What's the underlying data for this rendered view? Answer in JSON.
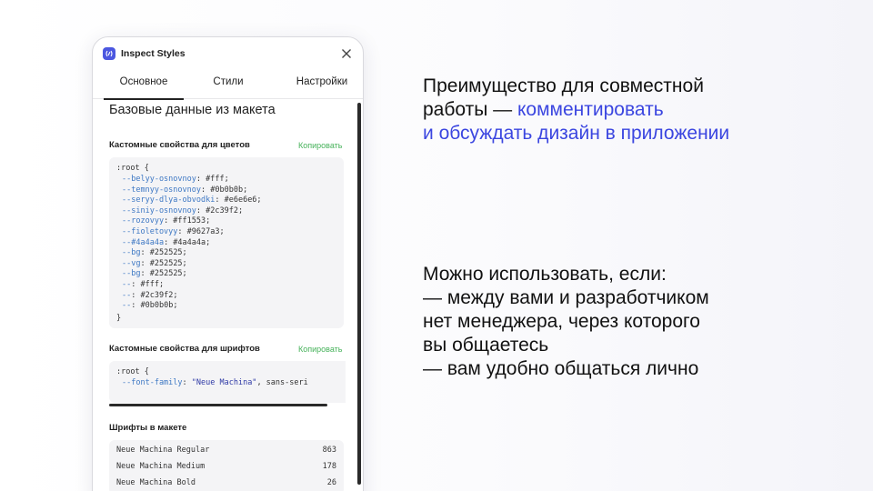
{
  "panel": {
    "title": "Inspect Styles",
    "tabs": [
      "Основное",
      "Стили",
      "Настройки"
    ],
    "active_tab": "Основное",
    "heading": "Базовые данные из макета",
    "colors_section": {
      "title": "Кастомные свойства для цветов",
      "copy_label": "Копировать",
      "open": ":root {",
      "close": "}",
      "lines": [
        {
          "name": "--belyy-osnovnoy",
          "value": " #fff;"
        },
        {
          "name": "--temnyy-osnovnoy",
          "value": " #0b0b0b;"
        },
        {
          "name": "--seryy-dlya-obvodki",
          "value": " #e6e6e6;"
        },
        {
          "name": "--siniy-osnovnoy",
          "value": " #2c39f2;"
        },
        {
          "name": "--rozovyy",
          "value": " #ff1553;"
        },
        {
          "name": "--fioletovyy",
          "value": " #9627a3;"
        },
        {
          "name": "--#4a4a4a",
          "value": " #4a4a4a;"
        },
        {
          "name": "--bg",
          "value": " #252525;"
        },
        {
          "name": "--vg",
          "value": " #252525;"
        },
        {
          "name": "--bg",
          "value": " #252525;"
        },
        {
          "name": "--",
          "value": " #fff;"
        },
        {
          "name": "--",
          "value": " #2c39f2;"
        },
        {
          "name": "--",
          "value": " #0b0b0b;"
        }
      ]
    },
    "fonts_props_section": {
      "title": "Кастомные свойства для шрифтов",
      "copy_label": "Копировать",
      "open": ":root {",
      "prop": "--font-family",
      "string_value": "\"Neue Machina\"",
      "rest": ", sans-seri"
    },
    "fonts_section": {
      "title": "Шрифты в макете",
      "rows": [
        {
          "name": "Neue Machina Regular",
          "count": "863"
        },
        {
          "name": "Neue Machina Medium",
          "count": "178"
        },
        {
          "name": "Neue Machina Bold",
          "count": "26"
        }
      ]
    }
  },
  "text": {
    "block1": {
      "line1": "Преимущество для совместной",
      "line2_plain": "работы — ",
      "line2_accent": "комментировать",
      "line3_accent": "и обсуждать дизайн в приложении"
    },
    "block2": {
      "lines": [
        "Можно использовать, если:",
        "— между вами и разработчиком",
        "нет менеджера, через которого",
        "вы общаетесь",
        "— вам удобно общаться лично"
      ]
    }
  },
  "colors": {
    "accent": "#3b46e0",
    "copy_green": "#46b25a",
    "var_blue": "#3e78c4",
    "app_icon": "#4b57e0"
  }
}
